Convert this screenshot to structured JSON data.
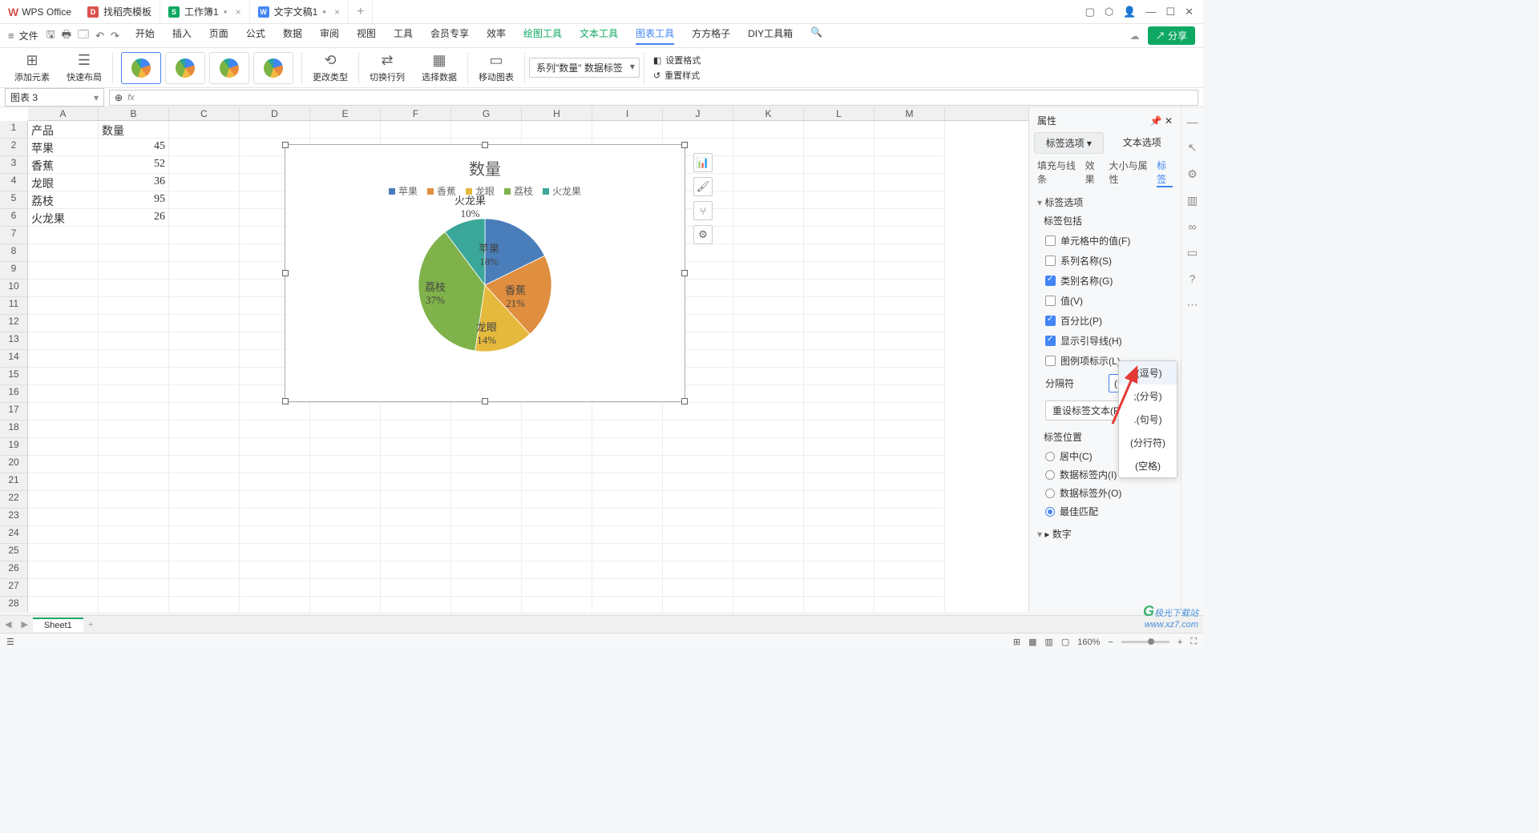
{
  "app": {
    "name": "WPS Office"
  },
  "tabs": [
    {
      "icon": "red",
      "label": "找稻壳模板"
    },
    {
      "icon": "green",
      "label": "工作簿1",
      "dirty": true,
      "close": true,
      "active": true
    },
    {
      "icon": "blue",
      "label": "文字文稿1",
      "dirty": true,
      "close": true
    }
  ],
  "file_label": "文件",
  "menus": [
    "开始",
    "插入",
    "页面",
    "公式",
    "数据",
    "审阅",
    "视图",
    "工具",
    "会员专享",
    "效率"
  ],
  "menus_green": [
    "绘图工具",
    "文本工具"
  ],
  "menu_active": "图表工具",
  "menus_after": [
    "方方格子",
    "DIY工具箱"
  ],
  "share": "分享",
  "ribbon": {
    "add_element": "添加元素",
    "quick_layout": "快速布局",
    "change_type": "更改类型",
    "swap": "切换行列",
    "select_data": "选择数据",
    "move": "移动图表",
    "set_fmt": "设置格式",
    "reset_style": "重置样式",
    "series_dd": "系列\"数量\" 数据标签"
  },
  "namebox": "图表 3",
  "columns": [
    "A",
    "B",
    "C",
    "D",
    "E",
    "F",
    "G",
    "H",
    "I",
    "J",
    "K",
    "L",
    "M"
  ],
  "data_rows": [
    [
      "产品",
      "数量"
    ],
    [
      "苹果",
      "45"
    ],
    [
      "香蕉",
      "52"
    ],
    [
      "龙眼",
      "36"
    ],
    [
      "荔枝",
      "95"
    ],
    [
      "火龙果",
      "26"
    ]
  ],
  "chart_data": {
    "type": "pie",
    "title": "数量",
    "series": [
      {
        "name": "苹果",
        "value": 45,
        "pct": "18%",
        "color": "#4a7ebb"
      },
      {
        "name": "香蕉",
        "value": 52,
        "pct": "21%",
        "color": "#e08e3f"
      },
      {
        "name": "龙眼",
        "value": 36,
        "pct": "14%",
        "color": "#e5b93c"
      },
      {
        "name": "荔枝",
        "value": 95,
        "pct": "37%",
        "color": "#7fb24a"
      },
      {
        "name": "火龙果",
        "value": 26,
        "pct": "10%",
        "color": "#3aa79a"
      }
    ]
  },
  "panel": {
    "title": "属性",
    "tab_label": "标签选项",
    "tab_text": "文本选项",
    "subtabs": [
      "填充与线条",
      "效果",
      "大小与属性",
      "标签"
    ],
    "section_label_opts": "标签选项",
    "label_contains": "标签包括",
    "chk_cell": "单元格中的值(F)",
    "chk_series": "系列名称(S)",
    "chk_cat": "类别名称(G)",
    "chk_val": "值(V)",
    "chk_pct": "百分比(P)",
    "chk_leader": "显示引导线(H)",
    "chk_legend": "图例项标示(L)",
    "separator": "分隔符",
    "sep_value": "(分行符)",
    "reset": "重设标签文本(R)",
    "pos_title": "标签位置",
    "pos_center": "居中(C)",
    "pos_inside": "数据标签内(I)",
    "pos_outside": "数据标签外(O)",
    "pos_best": "最佳匹配",
    "num_title": "数字",
    "dd_options": [
      ",(逗号)",
      ";(分号)",
      ".(句号)",
      "(分行符)",
      "(空格)"
    ]
  },
  "sheet_tab": "Sheet1",
  "zoom": "160%",
  "watermark": {
    "brand": "极光下载站",
    "url": "www.xz7.com"
  }
}
